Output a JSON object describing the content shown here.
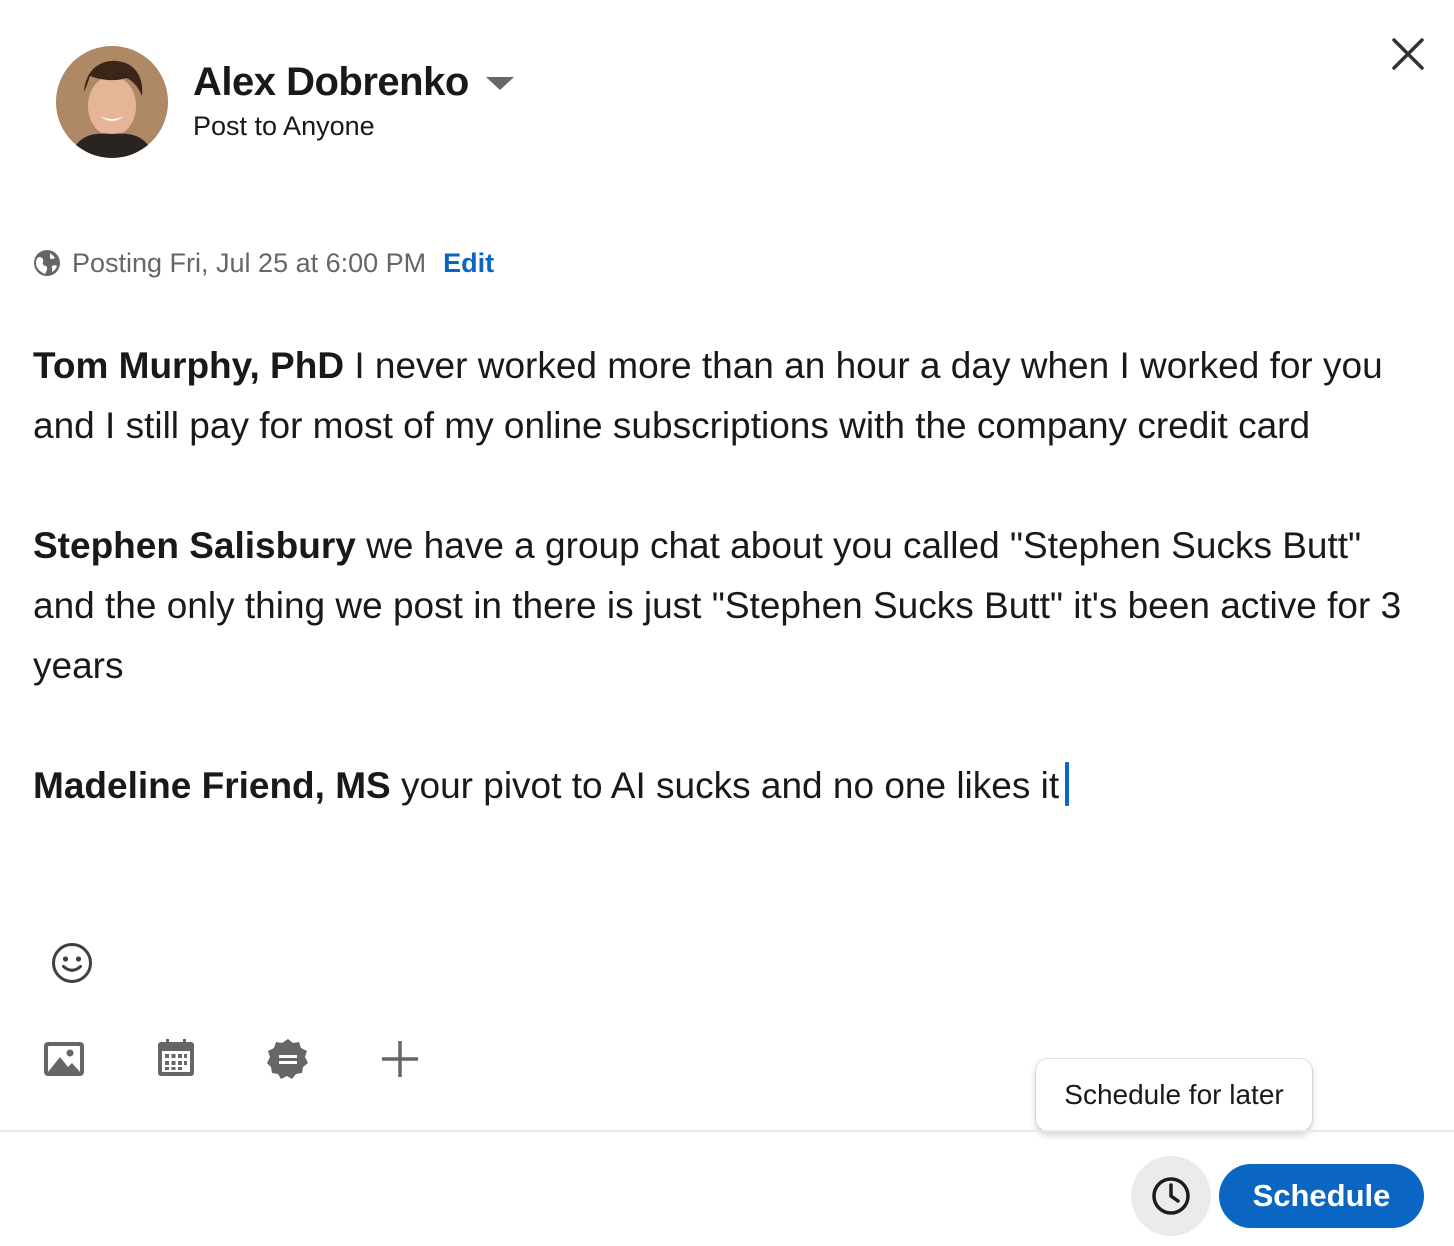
{
  "header": {
    "author_name": "Alex Dobrenko",
    "audience": "Post to Anyone",
    "avatar_icon": "profile-photo",
    "dropdown_icon": "caret-down-icon",
    "close_icon": "close-icon"
  },
  "schedule": {
    "globe_icon": "globe-icon",
    "posting_text": "Posting Fri, Jul 25 at 6:00 PM",
    "edit_label": "Edit"
  },
  "editor": {
    "paragraphs": [
      {
        "mention": "Tom Murphy, PhD",
        "text": " I never worked more than an hour a day when I worked for you and I still pay for most of my online subscriptions with the company credit card"
      },
      {
        "mention": "Stephen Salisbury",
        "text": " we have a group chat about you called \"Stephen Sucks Butt\" and the only thing we post in there is just \"Stephen Sucks Butt\" it's been active for 3 years"
      },
      {
        "mention": "Madeline Friend, MS",
        "text": " your pivot to AI sucks and no one likes it"
      }
    ]
  },
  "toolbar": {
    "emoji_icon": "smiley-icon",
    "tools": [
      {
        "icon": "image-icon"
      },
      {
        "icon": "calendar-icon"
      },
      {
        "icon": "badge-icon"
      },
      {
        "icon": "plus-icon"
      }
    ]
  },
  "footer": {
    "tooltip": "Schedule for later",
    "clock_icon": "clock-icon",
    "schedule_label": "Schedule"
  },
  "colors": {
    "accent": "#0a66c2",
    "text": "#191919",
    "muted": "#666666"
  }
}
